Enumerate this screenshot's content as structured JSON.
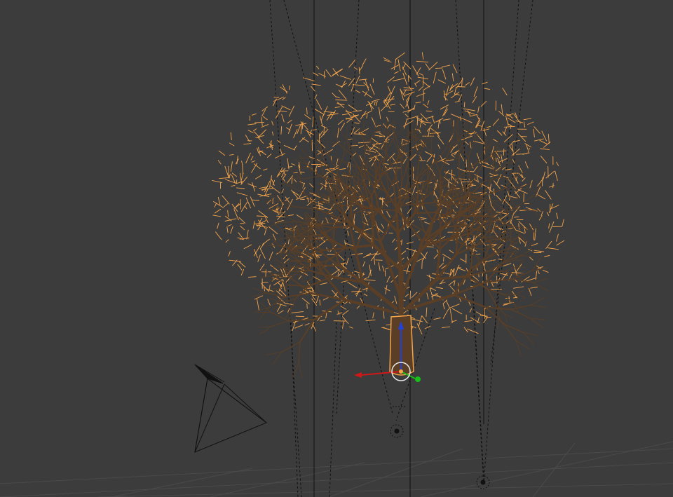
{
  "viewport": {
    "background_color": "#3c3c3c",
    "grid_color": "#4a4a4a",
    "selection_outline_color": "#f5a44a",
    "bark_color": "#5a3f26",
    "wire_color": "#111111",
    "axis_colors": {
      "x": "#d01818",
      "y": "#18c018",
      "z": "#2040e0"
    }
  },
  "scene_objects": [
    {
      "name": "tree",
      "selected": true,
      "icon": "tree-mesh-icon"
    },
    {
      "name": "camera",
      "selected": false,
      "icon": "camera-icon"
    },
    {
      "name": "spot-lamp-1",
      "selected": false,
      "icon": "spot-lamp-icon"
    },
    {
      "name": "spot-lamp-2",
      "selected": false,
      "icon": "spot-lamp-icon"
    }
  ],
  "transform_manipulator": {
    "visible": true,
    "axes": [
      "x",
      "y",
      "z"
    ]
  },
  "grid": {
    "visible": true
  }
}
